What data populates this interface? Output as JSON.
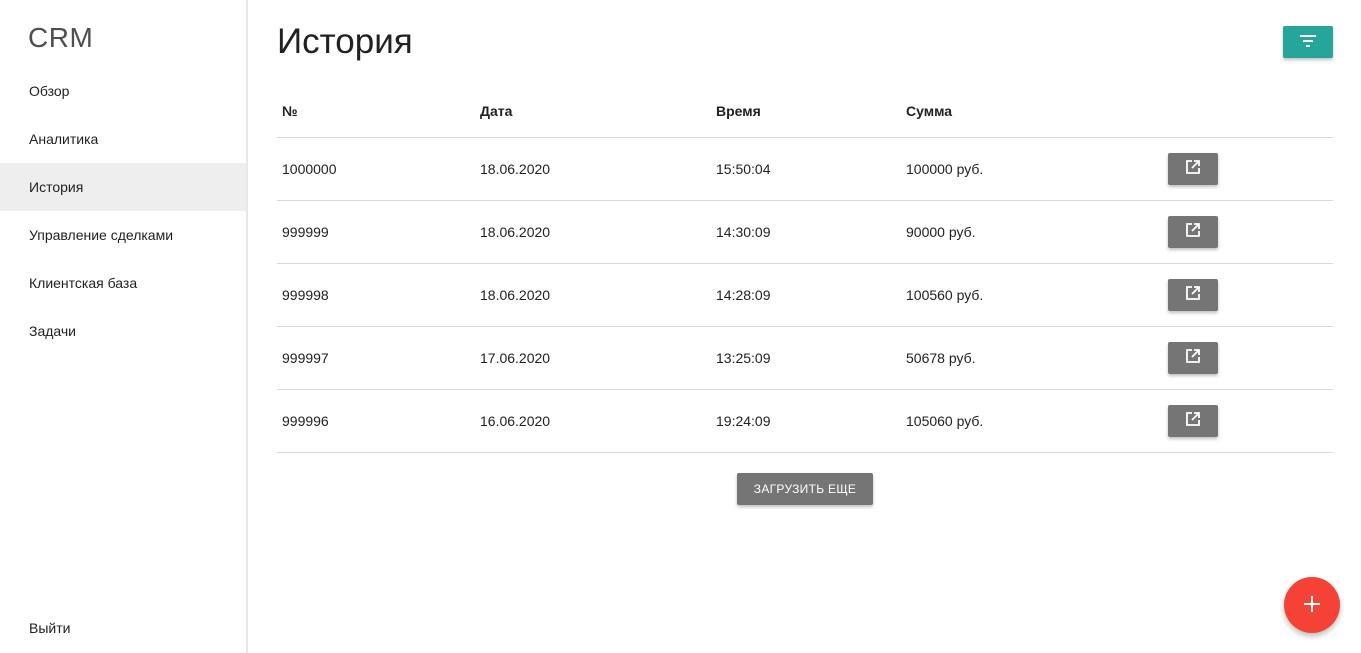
{
  "sidebar": {
    "brand": "CRM",
    "items": [
      {
        "label": "Обзор",
        "active": false
      },
      {
        "label": "Аналитика",
        "active": false
      },
      {
        "label": "История",
        "active": true
      },
      {
        "label": "Управление сделками",
        "active": false
      },
      {
        "label": "Клиентская база",
        "active": false
      },
      {
        "label": "Задачи",
        "active": false
      }
    ],
    "logout_label": "Выйти"
  },
  "main": {
    "title": "История",
    "filter_icon": "filter-list-icon",
    "table": {
      "headers": [
        "№",
        "Дата",
        "Время",
        "Сумма"
      ],
      "rows": [
        {
          "num": "1000000",
          "date": "18.06.2020",
          "time": "15:50:04",
          "sum": "100000 руб."
        },
        {
          "num": "999999",
          "date": "18.06.2020",
          "time": "14:30:09",
          "sum": "90000 руб."
        },
        {
          "num": "999998",
          "date": "18.06.2020",
          "time": "14:28:09",
          "sum": "100560 руб."
        },
        {
          "num": "999997",
          "date": "17.06.2020",
          "time": "13:25:09",
          "sum": "50678 руб."
        },
        {
          "num": "999996",
          "date": "16.06.2020",
          "time": "19:24:09",
          "sum": "105060 руб."
        }
      ],
      "row_action_icon": "open-in-new-icon"
    },
    "load_more_label": "ЗАГРУЗИТЬ ЕЩЕ"
  },
  "fab_icon": "add-icon",
  "colors": {
    "accent": "#26a69a",
    "fab": "#f44336",
    "button_gray": "#757575",
    "active_item_bg": "#eeeeee"
  }
}
